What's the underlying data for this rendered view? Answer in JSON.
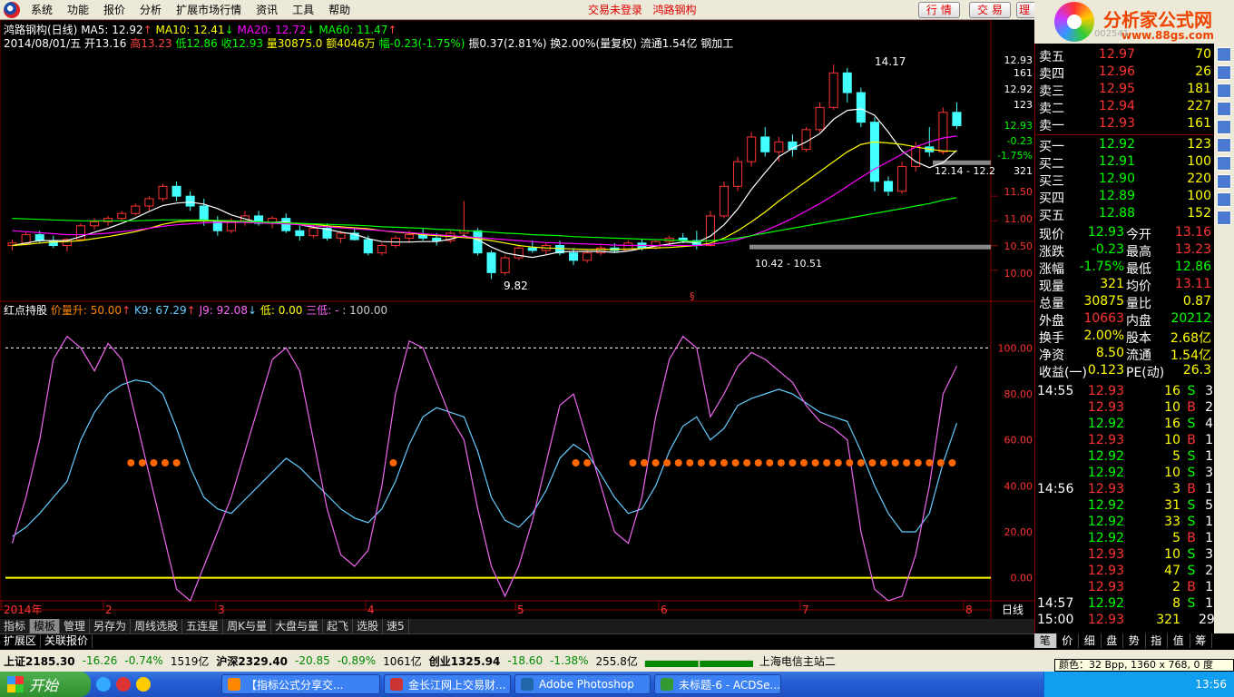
{
  "menu": {
    "items": [
      "系统",
      "功能",
      "报价",
      "分析",
      "扩展市场行情",
      "资讯",
      "工具",
      "帮助"
    ],
    "center_status": "交易未登录",
    "center_name": "鸿路钢构",
    "buttons": [
      "行 情",
      "交 易",
      "理财"
    ]
  },
  "banner": {
    "title": "分析家公式网",
    "url": "www.88gs.com",
    "hidden_code": "002541"
  },
  "stock": {
    "name": "鸿路钢构(日线)",
    "ma5": "MA5: 12.92",
    "ma10": "MA10: 12.41",
    "ma20": "MA20: 12.72",
    "ma60": "MA60: 11.47",
    "line2": {
      "date": "2014/08/01/五",
      "open": "开13.16",
      "high": "高13.23",
      "low": "低12.86",
      "close": "收12.93",
      "vol": "量30875.0",
      "amt": "额4046万",
      "chg": "幅-0.23(-1.75%)",
      "amp": "振0.37(2.81%)",
      "turn": "换2.00%(量复权)",
      "flow": "流通1.54亿",
      "industry": "钢加工"
    }
  },
  "price_axis": [
    "12.93",
    "161",
    "12.92",
    "123",
    "12.93",
    "-0.23",
    "-1.75%",
    "321",
    "11.50",
    "11.00",
    "10.50",
    "10.00"
  ],
  "annotations": {
    "max": "14.17",
    "min": "9.82",
    "range1": "12.14 - 12.2",
    "range2": "10.42 - 10.51",
    "marker": "§"
  },
  "indicator": {
    "name": "红点持股",
    "a": "价量升: 50.00",
    "b": "K9: 67.29",
    "c": "J9: 92.08",
    "d": "低: 0.00",
    "e": "三低: -",
    "f": ": 100.00",
    "axis": [
      "100.00",
      "80.00",
      "60.00",
      "40.00",
      "20.00",
      "0.00"
    ]
  },
  "months": [
    "2014年",
    "2",
    "3",
    "4",
    "5",
    "6",
    "7",
    "8"
  ],
  "period": "日线",
  "tabs": [
    "指标",
    "模板",
    "管理",
    "另存为",
    "周线选股",
    "五连星",
    "周K与量",
    "大盘与量",
    "起飞",
    "选股",
    "速5"
  ],
  "active_tab": "模板",
  "subtabs": [
    "扩展区",
    "关联报价"
  ],
  "quote": {
    "sell": [
      {
        "l": "卖五",
        "p": "12.97",
        "v": "70"
      },
      {
        "l": "卖四",
        "p": "12.96",
        "v": "26"
      },
      {
        "l": "卖三",
        "p": "12.95",
        "v": "181"
      },
      {
        "l": "卖二",
        "p": "12.94",
        "v": "227"
      },
      {
        "l": "卖一",
        "p": "12.93",
        "v": "161"
      }
    ],
    "buy": [
      {
        "l": "买一",
        "p": "12.92",
        "v": "123"
      },
      {
        "l": "买二",
        "p": "12.91",
        "v": "100"
      },
      {
        "l": "买三",
        "p": "12.90",
        "v": "220"
      },
      {
        "l": "买四",
        "p": "12.89",
        "v": "100"
      },
      {
        "l": "买五",
        "p": "12.88",
        "v": "152"
      }
    ],
    "stats": [
      [
        "现价",
        "12.93",
        "今开",
        "13.16"
      ],
      [
        "涨跌",
        "-0.23",
        "最高",
        "13.23"
      ],
      [
        "涨幅",
        "-1.75%",
        "最低",
        "12.86"
      ],
      [
        "现量",
        "321",
        "均价",
        "13.11"
      ],
      [
        "总量",
        "30875",
        "量比",
        "0.87"
      ],
      [
        "外盘",
        "10663",
        "内盘",
        "20212"
      ],
      [
        "换手",
        "2.00%",
        "股本",
        "2.68亿"
      ],
      [
        "净资",
        "8.50",
        "流通",
        "1.54亿"
      ],
      [
        "收益(一)",
        "0.123",
        "PE(动)",
        "26.3"
      ]
    ],
    "ticks": [
      [
        "14:55",
        "12.93",
        "16",
        "S",
        "3"
      ],
      [
        "",
        "12.93",
        "10",
        "B",
        "2"
      ],
      [
        "",
        "12.92",
        "16",
        "S",
        "4"
      ],
      [
        "",
        "12.93",
        "10",
        "B",
        "1"
      ],
      [
        "",
        "12.92",
        "5",
        "S",
        "1"
      ],
      [
        "",
        "12.92",
        "10",
        "S",
        "3"
      ],
      [
        "14:56",
        "12.93",
        "3",
        "B",
        "1"
      ],
      [
        "",
        "12.92",
        "31",
        "S",
        "5"
      ],
      [
        "",
        "12.92",
        "33",
        "S",
        "1"
      ],
      [
        "",
        "12.92",
        "5",
        "B",
        "1"
      ],
      [
        "",
        "12.93",
        "10",
        "S",
        "3"
      ],
      [
        "",
        "12.93",
        "47",
        "S",
        "2"
      ],
      [
        "",
        "12.93",
        "2",
        "B",
        "1"
      ],
      [
        "14:57",
        "12.92",
        "8",
        "S",
        "1"
      ],
      [
        "15:00",
        "12.93",
        "321",
        "",
        "29"
      ]
    ]
  },
  "quote_tabs": [
    "笔",
    "价",
    "细",
    "盘",
    "势",
    "指",
    "值",
    "筹"
  ],
  "status": {
    "sh": "上证2185.30",
    "sh_chg": "-16.26",
    "sh_pct": "-0.74%",
    "sh_amt": "1519亿",
    "sz": "沪深2329.40",
    "sz_chg": "-20.85",
    "sz_pct": "-0.89%",
    "sz_amt": "1061亿",
    "cy": "创业1325.94",
    "cy_chg": "-18.60",
    "cy_pct": "-1.38%",
    "cy_amt": "255.8亿",
    "server": "上海电信主站二"
  },
  "tooltip": "颜色：32 Bpp, 1360 x 768, 0 度",
  "taskbar": {
    "start": "开始",
    "tasks": [
      "【指标公式分享交...",
      "金长江网上交易财...",
      "Adobe Photoshop",
      "未标题-6 - ACDSe..."
    ],
    "clock": "13:56"
  },
  "chart_data": {
    "type": "candlestick+line",
    "price_ylim": [
      9.7,
      14.3
    ],
    "indicator_ylim": [
      -10,
      110
    ],
    "candles": [
      [
        10.5,
        10.62,
        10.4,
        10.55
      ],
      [
        10.55,
        10.78,
        10.5,
        10.72
      ],
      [
        10.72,
        10.8,
        10.55,
        10.6
      ],
      [
        10.6,
        10.7,
        10.45,
        10.5
      ],
      [
        10.5,
        10.65,
        10.38,
        10.62
      ],
      [
        10.62,
        10.95,
        10.6,
        10.9
      ],
      [
        10.9,
        11.05,
        10.82,
        10.98
      ],
      [
        10.98,
        11.1,
        10.9,
        11.05
      ],
      [
        11.05,
        11.2,
        10.98,
        11.15
      ],
      [
        11.15,
        11.35,
        11.1,
        11.3
      ],
      [
        11.3,
        11.5,
        11.2,
        11.45
      ],
      [
        11.45,
        11.75,
        11.4,
        11.7
      ],
      [
        11.7,
        11.8,
        11.4,
        11.5
      ],
      [
        11.5,
        11.6,
        11.2,
        11.3
      ],
      [
        11.3,
        11.45,
        10.9,
        11.0
      ],
      [
        11.0,
        11.1,
        10.7,
        10.8
      ],
      [
        10.8,
        11.05,
        10.75,
        11.0
      ],
      [
        11.0,
        11.2,
        10.9,
        11.1
      ],
      [
        11.1,
        11.2,
        10.9,
        10.95
      ],
      [
        10.95,
        11.1,
        10.85,
        11.05
      ],
      [
        11.05,
        11.15,
        10.75,
        10.8
      ],
      [
        10.8,
        10.9,
        10.6,
        10.7
      ],
      [
        10.7,
        10.9,
        10.65,
        10.85
      ],
      [
        10.85,
        10.95,
        10.6,
        10.65
      ],
      [
        10.65,
        10.8,
        10.55,
        10.75
      ],
      [
        10.75,
        10.85,
        10.6,
        10.62
      ],
      [
        10.62,
        10.7,
        10.3,
        10.35
      ],
      [
        10.35,
        10.55,
        10.3,
        10.5
      ],
      [
        10.5,
        10.7,
        10.45,
        10.65
      ],
      [
        10.65,
        10.8,
        10.55,
        10.72
      ],
      [
        10.72,
        10.85,
        10.6,
        10.65
      ],
      [
        10.65,
        10.75,
        10.5,
        10.6
      ],
      [
        10.6,
        10.8,
        10.55,
        10.75
      ],
      [
        10.75,
        11.4,
        10.7,
        10.8
      ],
      [
        10.8,
        10.85,
        10.3,
        10.35
      ],
      [
        10.35,
        10.4,
        9.82,
        9.95
      ],
      [
        9.95,
        10.3,
        9.9,
        10.25
      ],
      [
        10.25,
        10.5,
        10.2,
        10.45
      ],
      [
        10.45,
        10.6,
        10.35,
        10.4
      ],
      [
        10.4,
        10.55,
        10.3,
        10.5
      ],
      [
        10.5,
        10.6,
        10.3,
        10.35
      ],
      [
        10.35,
        10.45,
        10.1,
        10.2
      ],
      [
        10.2,
        10.4,
        10.15,
        10.35
      ],
      [
        10.35,
        10.5,
        10.3,
        10.45
      ],
      [
        10.45,
        10.55,
        10.35,
        10.4
      ],
      [
        10.4,
        10.6,
        10.38,
        10.55
      ],
      [
        10.55,
        10.62,
        10.4,
        10.45
      ],
      [
        10.45,
        10.6,
        10.42,
        10.58
      ],
      [
        10.58,
        10.7,
        10.5,
        10.65
      ],
      [
        10.65,
        10.75,
        10.55,
        10.6
      ],
      [
        10.6,
        10.8,
        10.42,
        10.5
      ],
      [
        10.5,
        11.2,
        10.48,
        11.1
      ],
      [
        11.1,
        11.8,
        11.05,
        11.7
      ],
      [
        11.7,
        12.3,
        11.6,
        12.2
      ],
      [
        12.2,
        12.8,
        12.1,
        12.7
      ],
      [
        12.7,
        12.9,
        12.3,
        12.4
      ],
      [
        12.4,
        12.7,
        12.2,
        12.6
      ],
      [
        12.6,
        12.75,
        12.3,
        12.45
      ],
      [
        12.45,
        12.9,
        12.4,
        12.85
      ],
      [
        12.85,
        13.4,
        12.8,
        13.3
      ],
      [
        13.3,
        14.17,
        13.25,
        14.0
      ],
      [
        14.0,
        14.1,
        13.4,
        13.6
      ],
      [
        13.6,
        13.7,
        12.9,
        13.0
      ],
      [
        13.0,
        13.1,
        11.6,
        11.8
      ],
      [
        11.8,
        11.9,
        11.5,
        11.6
      ],
      [
        11.6,
        12.2,
        11.55,
        12.1
      ],
      [
        12.1,
        12.6,
        12.0,
        12.5
      ],
      [
        12.5,
        12.9,
        12.3,
        12.4
      ],
      [
        12.4,
        13.3,
        12.35,
        13.2
      ],
      [
        13.2,
        13.4,
        12.86,
        12.93
      ]
    ],
    "ma5": [
      10.5,
      10.55,
      10.6,
      10.6,
      10.6,
      10.68,
      10.77,
      10.85,
      10.95,
      11.06,
      11.19,
      11.31,
      11.36,
      11.38,
      11.34,
      11.25,
      11.12,
      11.04,
      10.97,
      10.97,
      10.98,
      10.92,
      10.87,
      10.83,
      10.77,
      10.73,
      10.64,
      10.58,
      10.57,
      10.57,
      10.58,
      10.58,
      10.63,
      10.7,
      10.62,
      10.47,
      10.35,
      10.3,
      10.26,
      10.31,
      10.37,
      10.38,
      10.38,
      10.38,
      10.36,
      10.39,
      10.44,
      10.49,
      10.53,
      10.57,
      10.56,
      10.69,
      10.92,
      11.24,
      11.64,
      11.98,
      12.3,
      12.47,
      12.6,
      12.77,
      13.06,
      13.24,
      13.27,
      13.14,
      12.8,
      12.42,
      12.2,
      12.08,
      12.18,
      12.43
    ],
    "ma10": [
      10.5,
      10.52,
      10.55,
      10.57,
      10.58,
      10.6,
      10.64,
      10.68,
      10.73,
      10.78,
      10.85,
      10.93,
      10.98,
      11.0,
      11.0,
      11.0,
      10.98,
      10.97,
      10.96,
      10.96,
      10.95,
      10.94,
      10.93,
      10.9,
      10.88,
      10.86,
      10.84,
      10.8,
      10.77,
      10.75,
      10.72,
      10.7,
      10.68,
      10.66,
      10.64,
      10.6,
      10.55,
      10.5,
      10.47,
      10.45,
      10.44,
      10.43,
      10.42,
      10.42,
      10.42,
      10.43,
      10.44,
      10.45,
      10.46,
      10.48,
      10.5,
      10.55,
      10.65,
      10.8,
      10.98,
      11.18,
      11.4,
      11.6,
      11.8,
      12.0,
      12.2,
      12.4,
      12.55,
      12.6,
      12.58,
      12.55,
      12.5,
      12.45,
      12.42,
      12.41
    ],
    "ma20": [
      10.8,
      10.78,
      10.76,
      10.74,
      10.72,
      10.72,
      10.73,
      10.75,
      10.78,
      10.81,
      10.85,
      10.89,
      10.92,
      10.94,
      10.96,
      10.97,
      10.97,
      10.97,
      10.96,
      10.95,
      10.94,
      10.92,
      10.9,
      10.88,
      10.86,
      10.84,
      10.82,
      10.8,
      10.78,
      10.76,
      10.74,
      10.72,
      10.7,
      10.68,
      10.66,
      10.64,
      10.62,
      10.6,
      10.58,
      10.56,
      10.55,
      10.54,
      10.53,
      10.52,
      10.51,
      10.5,
      10.5,
      10.5,
      10.5,
      10.5,
      10.5,
      10.52,
      10.56,
      10.62,
      10.7,
      10.8,
      10.92,
      11.05,
      11.2,
      11.35,
      11.52,
      11.7,
      11.88,
      12.05,
      12.2,
      12.35,
      12.5,
      12.6,
      12.68,
      12.72
    ],
    "ma60": [
      11.05,
      11.04,
      11.03,
      11.02,
      11.01,
      11.0,
      11.0,
      11.0,
      11.0,
      11.0,
      11.01,
      11.02,
      11.02,
      11.02,
      11.02,
      11.01,
      11.0,
      10.99,
      10.98,
      10.97,
      10.96,
      10.95,
      10.94,
      10.93,
      10.92,
      10.91,
      10.9,
      10.88,
      10.87,
      10.86,
      10.85,
      10.83,
      10.82,
      10.8,
      10.79,
      10.77,
      10.75,
      10.74,
      10.72,
      10.71,
      10.7,
      10.68,
      10.67,
      10.66,
      10.65,
      10.64,
      10.63,
      10.62,
      10.61,
      10.6,
      10.58,
      10.6,
      10.62,
      10.65,
      10.7,
      10.75,
      10.8,
      10.85,
      10.9,
      10.95,
      11.0,
      11.05,
      11.1,
      11.15,
      11.2,
      11.25,
      11.3,
      11.35,
      11.42,
      11.47
    ],
    "k9": [
      18,
      22,
      28,
      35,
      42,
      60,
      72,
      80,
      84,
      86,
      85,
      80,
      65,
      48,
      35,
      30,
      28,
      34,
      40,
      46,
      52,
      48,
      42,
      36,
      30,
      26,
      24,
      30,
      42,
      58,
      70,
      74,
      72,
      70,
      55,
      35,
      25,
      22,
      28,
      38,
      52,
      58,
      54,
      45,
      35,
      28,
      30,
      40,
      55,
      66,
      70,
      60,
      65,
      75,
      78,
      80,
      82,
      80,
      76,
      72,
      70,
      68,
      55,
      40,
      28,
      20,
      20,
      28,
      50,
      67.29
    ],
    "j9": [
      15,
      35,
      60,
      95,
      105,
      100,
      90,
      102,
      95,
      70,
      45,
      20,
      -5,
      -10,
      5,
      20,
      35,
      55,
      75,
      95,
      100,
      90,
      60,
      30,
      10,
      5,
      12,
      40,
      80,
      103,
      100,
      85,
      70,
      60,
      30,
      5,
      -8,
      5,
      25,
      50,
      75,
      80,
      60,
      40,
      20,
      15,
      35,
      70,
      95,
      105,
      100,
      70,
      80,
      92,
      98,
      95,
      90,
      85,
      75,
      68,
      65,
      60,
      20,
      -5,
      -10,
      -8,
      10,
      40,
      80,
      92.08
    ],
    "red_dots": [
      11,
      12,
      13,
      14,
      15,
      34,
      50,
      51,
      55,
      56,
      57,
      58,
      59,
      60,
      61,
      62,
      63,
      64,
      65,
      66,
      67,
      68,
      69,
      70,
      71,
      72,
      73,
      74,
      75,
      76,
      77,
      78,
      79,
      80,
      81,
      82,
      83
    ]
  }
}
